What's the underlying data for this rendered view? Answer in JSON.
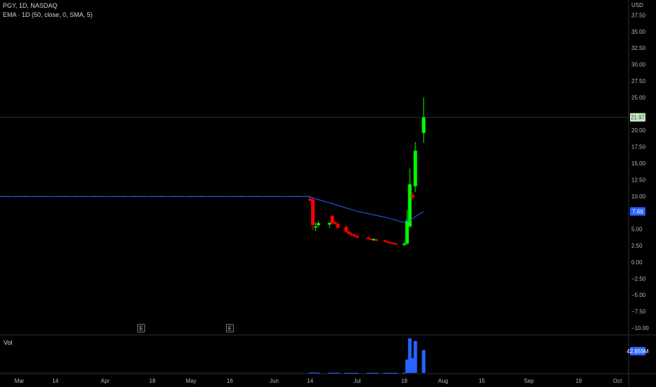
{
  "header": {
    "symbol_line": "PGY, 1D, NASDAQ",
    "indicator_line": "EMA · 1D (50, close, 0, SMA, 5)",
    "currency": "USD"
  },
  "volume_pane": {
    "label": "Vol",
    "last_value": "42.859M"
  },
  "colors": {
    "background": "#000000",
    "up": "#00ff00",
    "down": "#ff0000",
    "ema": "#2962ff",
    "volume": "#2962ff",
    "text": "#b2b5be",
    "crosshair": "#2a2e39"
  },
  "chart_data": {
    "type": "candlestick",
    "symbol": "PGY",
    "interval": "1D",
    "exchange": "NASDAQ",
    "y_axis": {
      "unit": "USD",
      "ticks": [
        37.5,
        35.0,
        32.5,
        30.0,
        27.5,
        25.0,
        22.5,
        20.0,
        17.5,
        15.0,
        12.5,
        10.0,
        7.5,
        5.0,
        2.5,
        0.0,
        -2.5,
        -5.0,
        -7.5,
        -10.0
      ],
      "tick_labels": [
        "37.50",
        "35.00",
        "32.50",
        "30.00",
        "27.50",
        "25.00",
        "22.50",
        "20.00",
        "17.50",
        "15.00",
        "12.50",
        "10.00",
        "7.50",
        "5.00",
        "2.50",
        "0.00",
        "−2.50",
        "−5.00",
        "−7.50",
        "−10.00"
      ],
      "range": [
        -10.0,
        38.5
      ]
    },
    "x_axis": {
      "ticks": [
        {
          "label": "Mar",
          "date": "2022-03-01"
        },
        {
          "label": "14",
          "date": "2022-03-14"
        },
        {
          "label": "Apr",
          "date": "2022-04-01"
        },
        {
          "label": "18",
          "date": "2022-04-18"
        },
        {
          "label": "May",
          "date": "2022-05-02"
        },
        {
          "label": "16",
          "date": "2022-05-16"
        },
        {
          "label": "Jun",
          "date": "2022-06-01"
        },
        {
          "label": "14",
          "date": "2022-06-14"
        },
        {
          "label": "Jul",
          "date": "2022-07-01"
        },
        {
          "label": "18",
          "date": "2022-07-18"
        },
        {
          "label": "Aug",
          "date": "2022-08-01"
        },
        {
          "label": "15",
          "date": "2022-08-15"
        },
        {
          "label": "Sep",
          "date": "2022-09-01"
        },
        {
          "label": "19",
          "date": "2022-09-19"
        },
        {
          "label": "Oct",
          "date": "2022-10-03"
        }
      ],
      "range": [
        "2022-02-22",
        "2022-10-07"
      ]
    },
    "flat_range": {
      "from": "2022-02-22",
      "to": "2022-06-13",
      "price": 9.95
    },
    "candles": [
      {
        "date": "2022-06-14",
        "o": 9.6,
        "h": 10.1,
        "l": 9.2,
        "c": 9.3
      },
      {
        "date": "2022-06-15",
        "o": 9.5,
        "h": 9.7,
        "l": 4.8,
        "c": 5.6
      },
      {
        "date": "2022-06-16",
        "o": 5.4,
        "h": 6.0,
        "l": 4.7,
        "c": 5.4
      },
      {
        "date": "2022-06-17",
        "o": 5.6,
        "h": 6.2,
        "l": 5.3,
        "c": 5.9
      },
      {
        "date": "2022-06-21",
        "o": 5.7,
        "h": 6.1,
        "l": 5.2,
        "c": 5.9
      },
      {
        "date": "2022-06-22",
        "o": 7.0,
        "h": 7.2,
        "l": 5.7,
        "c": 5.9
      },
      {
        "date": "2022-06-23",
        "o": 6.0,
        "h": 6.3,
        "l": 5.6,
        "c": 5.8
      },
      {
        "date": "2022-06-24",
        "o": 5.8,
        "h": 6.1,
        "l": 5.0,
        "c": 5.2
      },
      {
        "date": "2022-06-27",
        "o": 5.3,
        "h": 5.6,
        "l": 4.4,
        "c": 4.6
      },
      {
        "date": "2022-06-28",
        "o": 4.6,
        "h": 4.8,
        "l": 4.1,
        "c": 4.3
      },
      {
        "date": "2022-06-29",
        "o": 4.3,
        "h": 4.5,
        "l": 3.9,
        "c": 4.1
      },
      {
        "date": "2022-06-30",
        "o": 4.1,
        "h": 4.3,
        "l": 3.8,
        "c": 3.9
      },
      {
        "date": "2022-07-01",
        "o": 3.9,
        "h": 4.1,
        "l": 3.6,
        "c": 3.7
      },
      {
        "date": "2022-07-05",
        "o": 3.7,
        "h": 3.9,
        "l": 3.4,
        "c": 3.5
      },
      {
        "date": "2022-07-06",
        "o": 3.5,
        "h": 3.7,
        "l": 3.3,
        "c": 3.4
      },
      {
        "date": "2022-07-07",
        "o": 3.3,
        "h": 3.6,
        "l": 3.2,
        "c": 3.5
      },
      {
        "date": "2022-07-08",
        "o": 3.4,
        "h": 3.6,
        "l": 3.2,
        "c": 3.3
      },
      {
        "date": "2022-07-11",
        "o": 3.3,
        "h": 3.4,
        "l": 3.0,
        "c": 3.1
      },
      {
        "date": "2022-07-12",
        "o": 3.1,
        "h": 3.2,
        "l": 2.9,
        "c": 3.0
      },
      {
        "date": "2022-07-13",
        "o": 3.0,
        "h": 3.1,
        "l": 2.8,
        "c": 2.9
      },
      {
        "date": "2022-07-14",
        "o": 2.9,
        "h": 3.0,
        "l": 2.7,
        "c": 2.8
      },
      {
        "date": "2022-07-15",
        "o": 2.8,
        "h": 2.9,
        "l": 2.6,
        "c": 2.7
      },
      {
        "date": "2022-07-18",
        "o": 2.6,
        "h": 3.0,
        "l": 2.4,
        "c": 2.8
      },
      {
        "date": "2022-07-19",
        "o": 2.8,
        "h": 7.9,
        "l": 2.6,
        "c": 6.3
      },
      {
        "date": "2022-07-20",
        "o": 5.4,
        "h": 14.2,
        "l": 5.2,
        "c": 11.8
      },
      {
        "date": "2022-07-21",
        "o": 10.2,
        "h": 10.6,
        "l": 9.5,
        "c": 9.8
      },
      {
        "date": "2022-07-22",
        "o": 11.5,
        "h": 18.2,
        "l": 10.6,
        "c": 16.9
      },
      {
        "date": "2022-07-25",
        "o": 19.6,
        "h": 25.0,
        "l": 18.1,
        "c": 21.97
      }
    ],
    "ema": {
      "label": "EMA · 1D (50, close, 0, SMA, 5)",
      "last_value": 7.68,
      "points": [
        {
          "date": "2022-02-22",
          "v": 9.95
        },
        {
          "date": "2022-06-13",
          "v": 9.95
        },
        {
          "date": "2022-06-16",
          "v": 9.6
        },
        {
          "date": "2022-06-24",
          "v": 8.6
        },
        {
          "date": "2022-07-01",
          "v": 7.7
        },
        {
          "date": "2022-07-11",
          "v": 6.8
        },
        {
          "date": "2022-07-18",
          "v": 6.0
        },
        {
          "date": "2022-07-20",
          "v": 6.3
        },
        {
          "date": "2022-07-22",
          "v": 6.9
        },
        {
          "date": "2022-07-25",
          "v": 7.68
        }
      ]
    },
    "volume": {
      "unit": "shares",
      "last_value": 42859000,
      "baseline": 150000,
      "bars": [
        {
          "date": "2022-06-14",
          "v": 400000
        },
        {
          "date": "2022-06-15",
          "v": 900000
        },
        {
          "date": "2022-06-16",
          "v": 500000
        },
        {
          "date": "2022-06-17",
          "v": 300000
        },
        {
          "date": "2022-06-21",
          "v": 250000
        },
        {
          "date": "2022-06-22",
          "v": 300000
        },
        {
          "date": "2022-06-23",
          "v": 250000
        },
        {
          "date": "2022-06-24",
          "v": 250000
        },
        {
          "date": "2022-06-27",
          "v": 200000
        },
        {
          "date": "2022-06-28",
          "v": 200000
        },
        {
          "date": "2022-06-29",
          "v": 200000
        },
        {
          "date": "2022-06-30",
          "v": 200000
        },
        {
          "date": "2022-07-01",
          "v": 200000
        },
        {
          "date": "2022-07-05",
          "v": 200000
        },
        {
          "date": "2022-07-06",
          "v": 200000
        },
        {
          "date": "2022-07-07",
          "v": 200000
        },
        {
          "date": "2022-07-08",
          "v": 200000
        },
        {
          "date": "2022-07-11",
          "v": 200000
        },
        {
          "date": "2022-07-12",
          "v": 200000
        },
        {
          "date": "2022-07-13",
          "v": 200000
        },
        {
          "date": "2022-07-14",
          "v": 200000
        },
        {
          "date": "2022-07-15",
          "v": 200000
        },
        {
          "date": "2022-07-18",
          "v": 300000
        },
        {
          "date": "2022-07-19",
          "v": 25000000
        },
        {
          "date": "2022-07-20",
          "v": 65000000
        },
        {
          "date": "2022-07-21",
          "v": 28000000
        },
        {
          "date": "2022-07-22",
          "v": 60000000
        },
        {
          "date": "2022-07-25",
          "v": 42859000
        }
      ]
    },
    "price_labels": {
      "last_price": "21.97",
      "ema_value": "7.68",
      "volume_value": "42.859M"
    },
    "event_markers": [
      {
        "date": "2022-04-14",
        "label": "E"
      },
      {
        "date": "2022-05-16",
        "label": "E"
      }
    ],
    "grid": false
  }
}
